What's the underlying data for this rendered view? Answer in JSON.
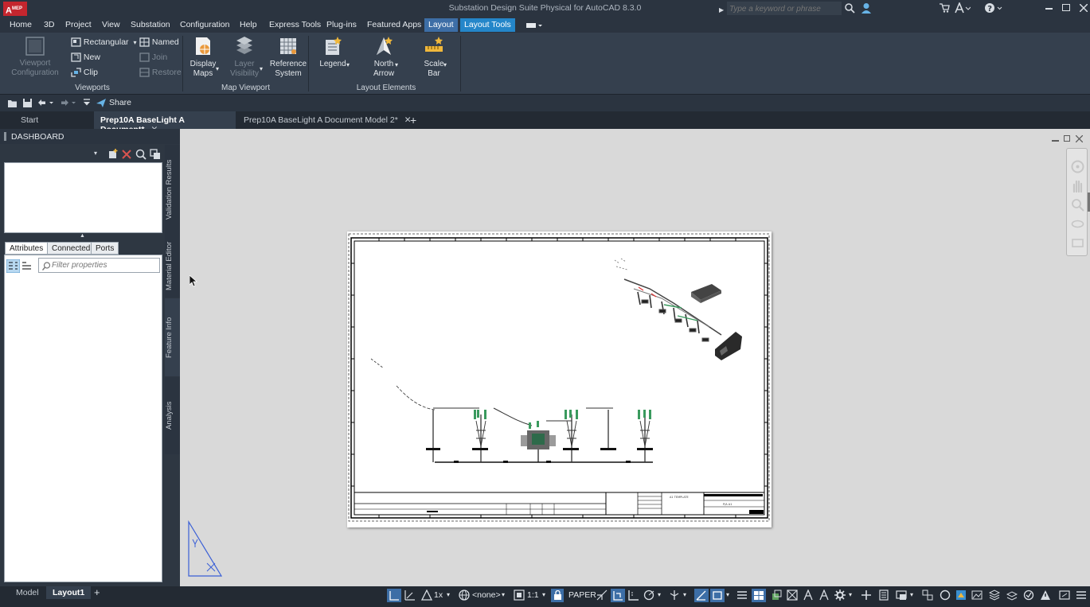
{
  "app": {
    "logo": "A",
    "logo_sub": "MEP",
    "title": "Substation Design Suite Physical for AutoCAD 8.3.0",
    "search_placeholder": "Type a keyword or phrase"
  },
  "menu": {
    "tabs": [
      "Home",
      "3D",
      "Project",
      "View",
      "Substation",
      "Configuration",
      "Help",
      "Express Tools",
      "Plug-ins",
      "Featured Apps",
      "Layout",
      "Layout Tools"
    ]
  },
  "ribbon": {
    "viewports": {
      "viewport_config_line1": "Viewport",
      "viewport_config_line2": "Configuration",
      "rectangular": "Rectangular",
      "new": "New",
      "clip": "Clip",
      "named": "Named",
      "join": "Join",
      "restore": "Restore",
      "label": "Viewports"
    },
    "map_viewport": {
      "display_maps_1": "Display",
      "display_maps_2": "Maps",
      "layer_visibility_1": "Layer",
      "layer_visibility_2": "Visibility",
      "reference_system_1": "Reference",
      "reference_system_2": "System",
      "label": "Map Viewport"
    },
    "layout_elements": {
      "legend": "Legend",
      "north_arrow_1": "North",
      "north_arrow_2": "Arrow",
      "scale_bar_1": "Scale",
      "scale_bar_2": "Bar",
      "label": "Layout Elements"
    }
  },
  "qat": {
    "share": "Share"
  },
  "doc_tabs": [
    {
      "label": "Start"
    },
    {
      "label": "Prep10A BaseLight A Document*"
    },
    {
      "label": "Prep10A BaseLight A Document Model 2*"
    }
  ],
  "dashboard": {
    "title": "DASHBOARD",
    "attr_tabs": [
      "Attributes",
      "Connected",
      "Ports"
    ],
    "filter_placeholder": "Filter properties",
    "side_tabs": [
      "Validation Results",
      "Material Editor",
      "Feature Info",
      "Analysis"
    ]
  },
  "drawing": {
    "title_block_text": "A1 TEMPLATE",
    "sheet_text": "P/A A1"
  },
  "status": {
    "layout_tabs": [
      "Model",
      "Layout1"
    ],
    "scale_factor": "1x",
    "coord_system": "<none>",
    "viewport_scale": "1:1",
    "space": "PAPER"
  },
  "colors": {
    "accent": "#2486c9",
    "chrome": "#2b3440",
    "ribbon": "#35404e",
    "logo_red": "#c4262e",
    "ucs_blue": "#3a5fd6"
  }
}
